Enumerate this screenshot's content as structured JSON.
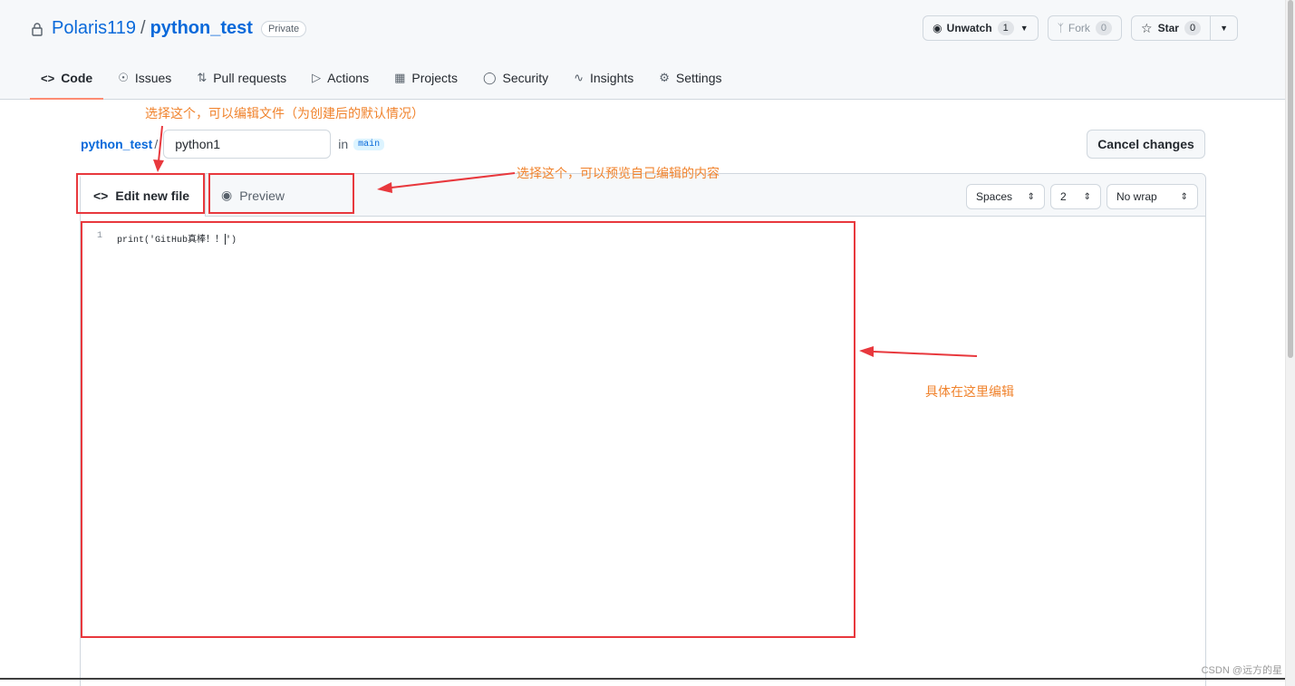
{
  "repo": {
    "owner": "Polaris119",
    "separator": "/",
    "name": "python_test",
    "visibility": "Private"
  },
  "actions": {
    "unwatch_label": "Unwatch",
    "unwatch_count": "1",
    "fork_label": "Fork",
    "fork_count": "0",
    "star_label": "Star",
    "star_count": "0"
  },
  "tabs": [
    {
      "label": "Code",
      "icon": "code-icon",
      "active": true
    },
    {
      "label": "Issues",
      "icon": "issue-icon"
    },
    {
      "label": "Pull requests",
      "icon": "pull-request-icon"
    },
    {
      "label": "Actions",
      "icon": "play-icon"
    },
    {
      "label": "Projects",
      "icon": "table-icon"
    },
    {
      "label": "Security",
      "icon": "shield-icon"
    },
    {
      "label": "Insights",
      "icon": "graph-icon"
    },
    {
      "label": "Settings",
      "icon": "gear-icon"
    }
  ],
  "breadcrumb": {
    "repo": "python_test",
    "separator": "/",
    "filename": "python1",
    "in_text": "in",
    "branch": "main"
  },
  "cancel_label": "Cancel changes",
  "editor": {
    "edit_tab": "Edit new file",
    "preview_tab": "Preview",
    "indent_mode": "Spaces",
    "indent_size": "2",
    "wrap_mode": "No wrap",
    "lines": [
      {
        "number": "1",
        "text": "print('GitHub真棒！！"
      }
    ],
    "line_end": "')"
  },
  "annotations": {
    "edit_note": "选择这个，可以编辑文件（为创建后的默认情况）",
    "preview_note": "选择这个，可以预览自己编辑的内容",
    "editor_note": "具体在这里编辑",
    "color": "#e8383d",
    "text_color": "#f0832d"
  },
  "watermark": "CSDN @远方的星"
}
